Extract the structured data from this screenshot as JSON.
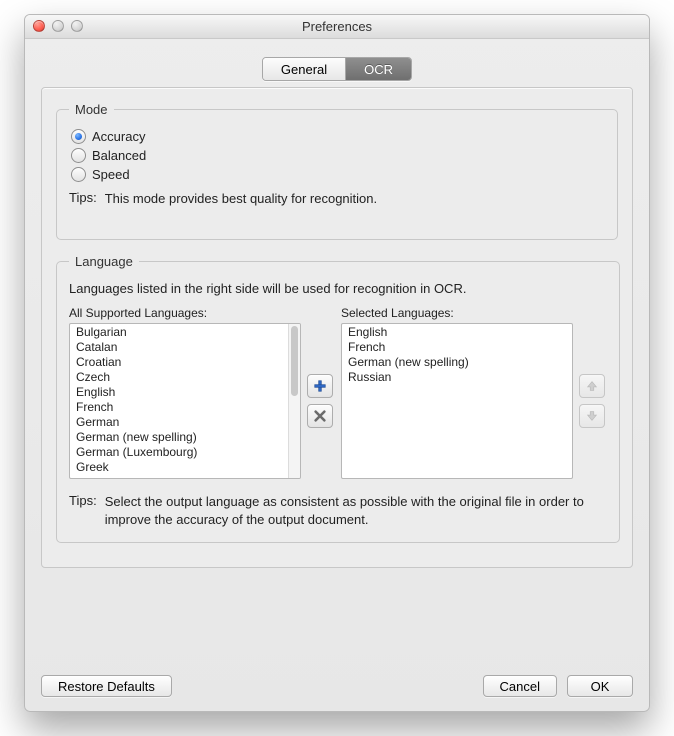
{
  "window": {
    "title": "Preferences"
  },
  "tabs": {
    "general": "General",
    "ocr": "OCR",
    "active": "ocr"
  },
  "mode": {
    "legend": "Mode",
    "options": {
      "accuracy": "Accuracy",
      "balanced": "Balanced",
      "speed": "Speed"
    },
    "selected": "accuracy",
    "tips_label": "Tips:",
    "tips_text": "This mode provides best quality for recognition."
  },
  "language": {
    "legend": "Language",
    "description": "Languages listed in the right side will be used for recognition in OCR.",
    "all_label": "All Supported Languages:",
    "selected_label": "Selected Languages:",
    "all": [
      "Bulgarian",
      "Catalan",
      "Croatian",
      "Czech",
      "English",
      "French",
      "German",
      "German (new spelling)",
      "German (Luxembourg)",
      "Greek"
    ],
    "selected": [
      "English",
      "French",
      "German (new spelling)",
      "Russian"
    ],
    "tips_label": "Tips:",
    "tips_text": "Select the output language as consistent as possible with the original file in order to improve the accuracy of the output document."
  },
  "buttons": {
    "restore": "Restore Defaults",
    "cancel": "Cancel",
    "ok": "OK"
  },
  "colors": {
    "accent": "#2b74e6"
  }
}
